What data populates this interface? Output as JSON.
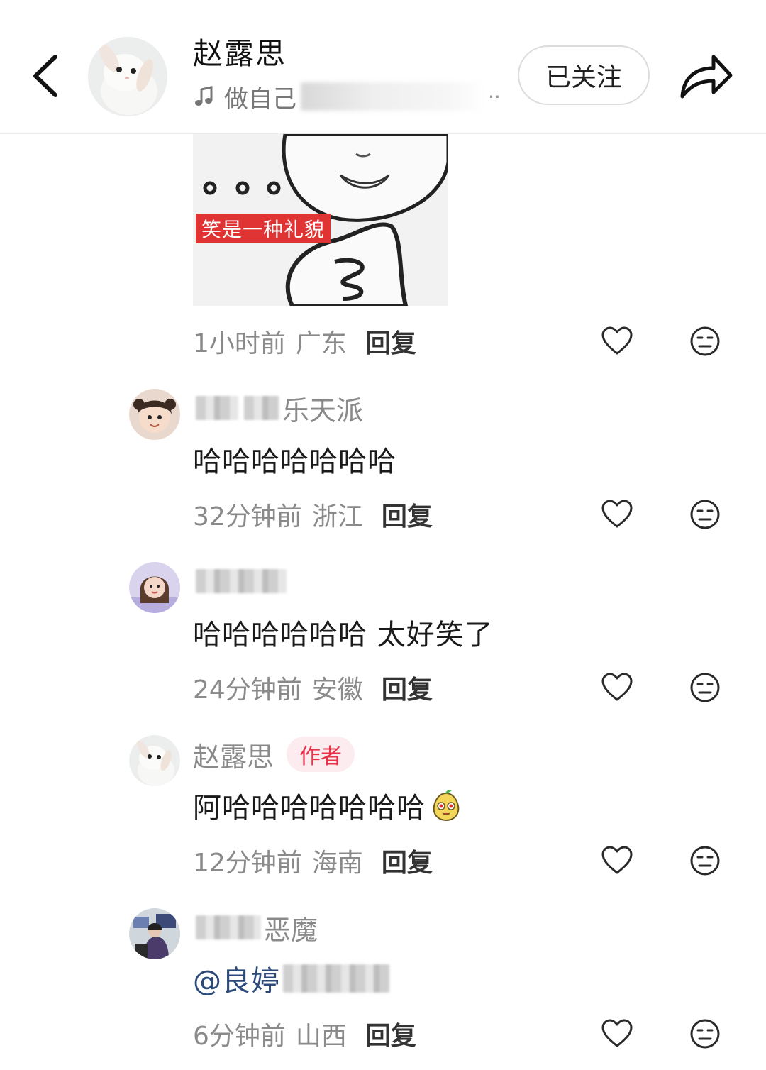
{
  "header": {
    "name": "赵露思",
    "music_text": "做自己",
    "music_ellipsis": "··",
    "follow_label": "已关注"
  },
  "meme": {
    "caption": "笑是一种礼貌"
  },
  "top_meta": {
    "time": "1小时前",
    "location": "广东",
    "reply": "回复"
  },
  "comments": [
    {
      "name": "霸气外露乐天派",
      "name_visible_suffix": "乐天派",
      "text": "哈哈哈哈哈哈哈",
      "time": "32分钟前",
      "location": "浙江",
      "reply": "回复"
    },
    {
      "name_visible_suffix": "",
      "text": "哈哈哈哈哈哈 太好笑了",
      "time": "24分钟前",
      "location": "安徽",
      "reply": "回复"
    },
    {
      "name": "赵露思",
      "badge": "作者",
      "text": "阿哈哈哈哈哈哈哈",
      "emoji": "pear-face-emoji",
      "time": "12分钟前",
      "location": "海南",
      "reply": "回复"
    },
    {
      "name_visible_suffix": "恶魔",
      "text": "@良婷",
      "time": "6分钟前",
      "location": "山西",
      "reply": "回复"
    }
  ],
  "icons": {
    "back": "chevron-left-icon",
    "share": "share-arrow-icon",
    "music": "music-note-icon",
    "like": "heart-outline-icon",
    "dislike": "meh-face-icon"
  },
  "colors": {
    "author_badge_bg": "#fdecef",
    "author_badge_text": "#e8334a",
    "meme_caption_bg": "#e03434",
    "mention": "#2b4a7a"
  }
}
